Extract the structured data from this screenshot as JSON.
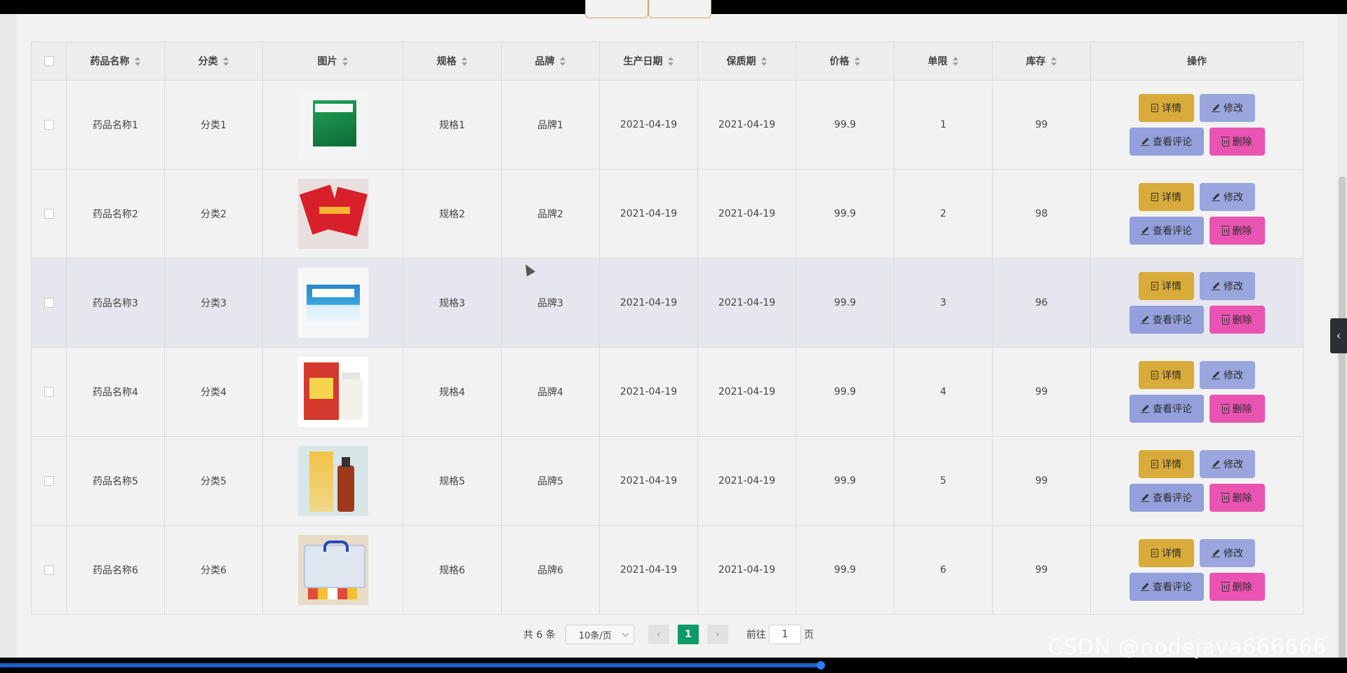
{
  "table": {
    "headers": {
      "name": "药品名称",
      "category": "分类",
      "image": "图片",
      "spec": "规格",
      "brand": "品牌",
      "mfg_date": "生产日期",
      "shelf_life": "保质期",
      "price": "价格",
      "limit": "单限",
      "stock": "库存",
      "ops": "操作"
    },
    "rows": [
      {
        "name": "药品名称1",
        "category": "分类1",
        "spec": "规格1",
        "brand": "品牌1",
        "mfg_date": "2021-04-19",
        "shelf_life": "2021-04-19",
        "price": "99.9",
        "limit": "1",
        "stock": "99"
      },
      {
        "name": "药品名称2",
        "category": "分类2",
        "spec": "规格2",
        "brand": "品牌2",
        "mfg_date": "2021-04-19",
        "shelf_life": "2021-04-19",
        "price": "99.9",
        "limit": "2",
        "stock": "98"
      },
      {
        "name": "药品名称3",
        "category": "分类3",
        "spec": "规格3",
        "brand": "品牌3",
        "mfg_date": "2021-04-19",
        "shelf_life": "2021-04-19",
        "price": "99.9",
        "limit": "3",
        "stock": "96"
      },
      {
        "name": "药品名称4",
        "category": "分类4",
        "spec": "规格4",
        "brand": "品牌4",
        "mfg_date": "2021-04-19",
        "shelf_life": "2021-04-19",
        "price": "99.9",
        "limit": "4",
        "stock": "99"
      },
      {
        "name": "药品名称5",
        "category": "分类5",
        "spec": "规格5",
        "brand": "品牌5",
        "mfg_date": "2021-04-19",
        "shelf_life": "2021-04-19",
        "price": "99.9",
        "limit": "5",
        "stock": "99"
      },
      {
        "name": "药品名称6",
        "category": "分类6",
        "spec": "规格6",
        "brand": "品牌6",
        "mfg_date": "2021-04-19",
        "shelf_life": "2021-04-19",
        "price": "99.9",
        "limit": "6",
        "stock": "99"
      }
    ],
    "actions": {
      "detail": "详情",
      "edit": "修改",
      "comments": "查看评论",
      "delete": "删除"
    }
  },
  "pagination": {
    "total": "共 6 条",
    "page_size": "10条/页",
    "current_page": "1",
    "goto_prefix": "前往",
    "goto_value": "1",
    "goto_suffix": "页"
  },
  "watermark": "CSDN @nodejava666666",
  "colors": {
    "detail_button": "#d8ab3a",
    "edit_button": "#9aa6dd",
    "comments_button": "#93a0dc",
    "delete_button": "#e954b2",
    "active_page": "#0d9b67"
  }
}
